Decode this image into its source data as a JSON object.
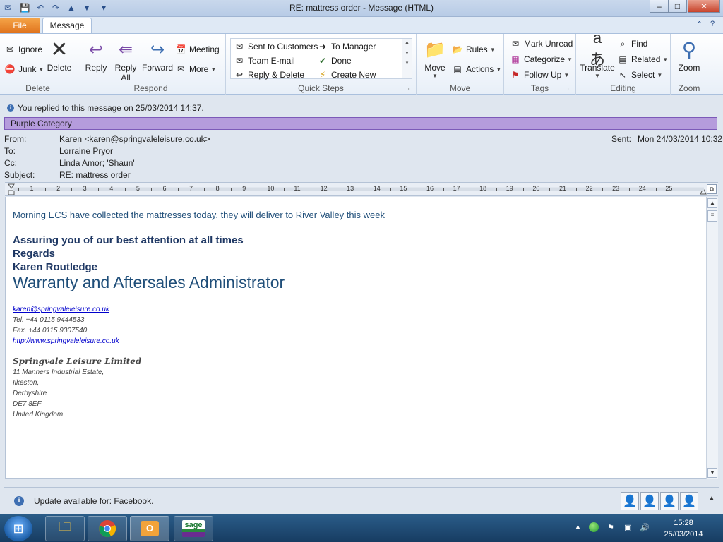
{
  "window": {
    "title": "RE: mattress order  -  Message (HTML)",
    "minimize": "–",
    "restore": "□",
    "close": "✕"
  },
  "tabs": {
    "file": "File",
    "message": "Message"
  },
  "ribbon": {
    "delete_group": {
      "label": "Delete",
      "ignore": "Ignore",
      "junk": "Junk",
      "delete": "Delete"
    },
    "respond_group": {
      "label": "Respond",
      "reply": "Reply",
      "reply_all_line1": "Reply",
      "reply_all_line2": "All",
      "forward": "Forward",
      "meeting": "Meeting",
      "more": "More"
    },
    "quick_steps": {
      "label": "Quick Steps",
      "items": [
        "Sent to Customers",
        "Team E-mail",
        "Reply & Delete",
        "To Manager",
        "Done",
        "Create New"
      ]
    },
    "move_group": {
      "label": "Move",
      "move": "Move",
      "rules": "Rules",
      "actions": "Actions"
    },
    "tags_group": {
      "label": "Tags",
      "mark_unread": "Mark Unread",
      "categorize": "Categorize",
      "follow_up": "Follow Up"
    },
    "editing_group": {
      "label": "Editing",
      "translate": "Translate",
      "find": "Find",
      "related": "Related",
      "select": "Select"
    },
    "zoom_group": {
      "label": "Zoom",
      "zoom": "Zoom"
    }
  },
  "info": {
    "replied": "You replied to this message on 25/03/2014 14:37.",
    "category": "Purple Category"
  },
  "header": {
    "from_label": "From:",
    "from_value": "Karen <karen@springvaleleisure.co.uk>",
    "to_label": "To:",
    "to_value": "Lorraine Pryor",
    "cc_label": "Cc:",
    "cc_value": "Linda Amor; 'Shaun'",
    "subject_label": "Subject:",
    "subject_value": "RE: mattress order",
    "sent_label": "Sent:",
    "sent_value": "Mon 24/03/2014 10:32"
  },
  "ruler": {
    "ticks": [
      "1",
      "2",
      "3",
      "4",
      "5",
      "6",
      "7",
      "8",
      "9",
      "10",
      "11",
      "12",
      "13",
      "14",
      "15",
      "16",
      "17",
      "18",
      "19",
      "20",
      "21",
      "22",
      "23",
      "24",
      "25"
    ]
  },
  "body": {
    "line1": "Morning ECS have collected the mattresses today, they will deliver to River Valley this week",
    "assuring": "Assuring you of our best attention at all times",
    "regards": "Regards",
    "name": "Karen Routledge",
    "role": "Warranty and Aftersales Administrator",
    "email": "karen@springvaleleisure.co.uk",
    "tel": "Tel.  +44 0115 9444533",
    "fax": "Fax. +44 0115 9307540",
    "website": "http://www.springvaleleisure.co.uk",
    "company": "Springvale Leisure Limited",
    "address": [
      "11 Manners Industrial Estate,",
      "Ilkeston,",
      "Derbyshire",
      "DE7 8EF",
      "United Kingdom"
    ]
  },
  "update_bar": {
    "text": "Update available for: Facebook."
  },
  "taskbar": {
    "time": "15:28",
    "date": "25/03/2014",
    "sage": "sage"
  }
}
